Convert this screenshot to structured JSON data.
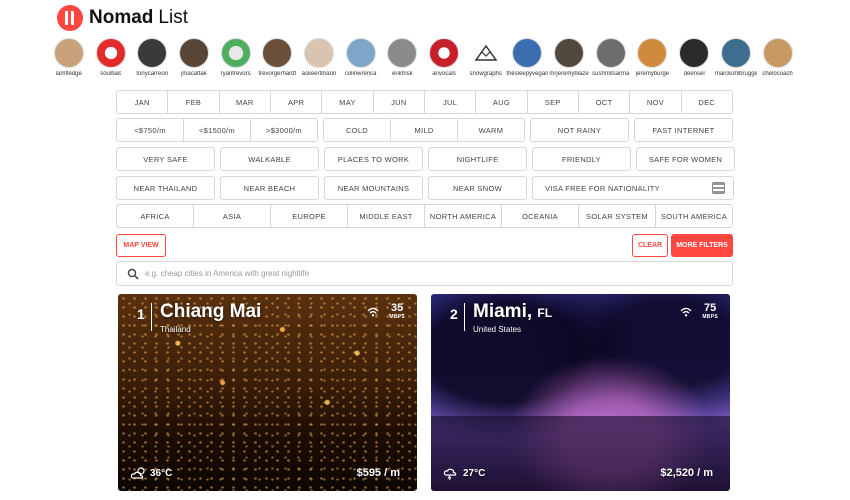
{
  "brand": {
    "name_bold": "Nomad",
    "name_light": "List",
    "accent_color": "#ff4742"
  },
  "users": [
    {
      "name": "lamfledge",
      "color": "#c9a27c"
    },
    {
      "name": "soulbait",
      "color": "#e32b2b"
    },
    {
      "name": "tonycarreon",
      "color": "#3a3a3a"
    },
    {
      "name": "jmacattak",
      "color": "#5a4636"
    },
    {
      "name": "ryantrevors",
      "color": "#4fae5e"
    },
    {
      "name": "trevorgerhardt",
      "color": "#6b4f3a"
    },
    {
      "name": "askeertmann",
      "color": "#d8c4b0"
    },
    {
      "name": "colinwrenca",
      "color": "#7ea6c8"
    },
    {
      "name": "erikfrisk",
      "color": "#8a8a8a"
    },
    {
      "name": "arivocals",
      "color": "#c8202b"
    },
    {
      "name": "snowgraphs",
      "color": "#ffffff"
    },
    {
      "name": "thesleepyvegan",
      "color": "#3c6db0"
    },
    {
      "name": "mrjeremyblaze",
      "color": "#53483e"
    },
    {
      "name": "sushmitsarma",
      "color": "#6e6e6e"
    },
    {
      "name": "jeremyburge",
      "color": "#d08a3c"
    },
    {
      "name": "deensel",
      "color": "#2a2a2a"
    },
    {
      "name": "marckohlbrugge",
      "color": "#3d6d8f"
    },
    {
      "name": "chelocoach",
      "color": "#c79a63"
    }
  ],
  "months": [
    "JAN",
    "FEB",
    "MAR",
    "APR",
    "MAY",
    "JUN",
    "JUL",
    "AUG",
    "SEP",
    "OCT",
    "NOV",
    "DEC"
  ],
  "budget": [
    "<$750/m",
    "<$1500/m",
    ">$3000/m"
  ],
  "climate": [
    "COLD",
    "MILD",
    "WARM"
  ],
  "row2_extra": [
    "NOT RAINY",
    "FAST INTERNET"
  ],
  "row3": [
    "VERY SAFE",
    "WALKABLE",
    "PLACES TO WORK",
    "NIGHTLIFE",
    "FRIENDLY",
    "SAFE FOR WOMEN"
  ],
  "row4": [
    "NEAR THAILAND",
    "NEAR BEACH",
    "NEAR MOUNTAINS",
    "NEAR SNOW"
  ],
  "visa_label": "VISA FREE FOR NATIONALITY",
  "regions": [
    "AFRICA",
    "ASIA",
    "EUROPE",
    "MIDDLE EAST",
    "NORTH AMERICA",
    "OCEANIA",
    "SOLAR SYSTEM",
    "SOUTH AMERICA"
  ],
  "actions": {
    "map_view": "MAP VIEW",
    "clear": "CLEAR",
    "more_filters": "MORE FILTERS"
  },
  "search": {
    "placeholder": "e.g. cheap cities in America with great nightlife",
    "value": ""
  },
  "cities": [
    {
      "rank": "1",
      "name": "Chiang Mai",
      "suffix": "",
      "country": "Thailand",
      "speed": "35",
      "speed_unit": "MBPS",
      "temp": "36°C",
      "weather": "partly-cloudy-icon",
      "cost": "$595 / m"
    },
    {
      "rank": "2",
      "name": "Miami,",
      "suffix": "FL",
      "country": "United States",
      "speed": "75",
      "speed_unit": "MBPS",
      "temp": "27°C",
      "weather": "thunderstorm-icon",
      "cost": "$2,520 / m"
    }
  ]
}
